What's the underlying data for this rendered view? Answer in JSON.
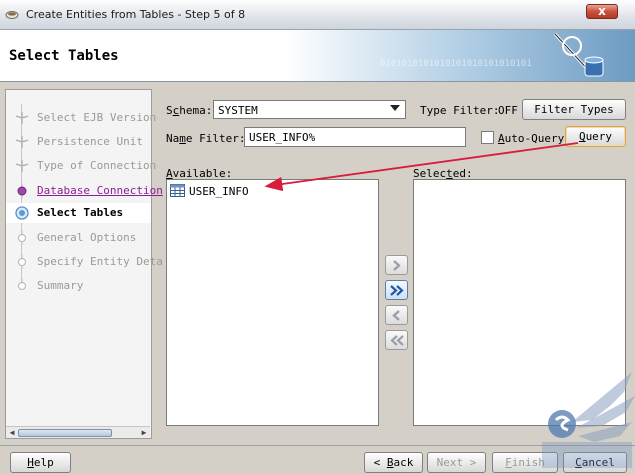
{
  "window": {
    "title": "Create Entities from Tables - Step 5 of 8",
    "close_glyph": "x"
  },
  "header": {
    "title": "Select Tables",
    "banner_binary": "0101010101010101010101010101"
  },
  "nav": {
    "items": [
      {
        "label": "Select EJB Version",
        "state": "done"
      },
      {
        "label": "Persistence Unit",
        "state": "done"
      },
      {
        "label": "Type of Connection",
        "state": "done"
      },
      {
        "label": "Database Connection",
        "state": "visited"
      },
      {
        "label": "Select Tables",
        "state": "active"
      },
      {
        "label": "General Options",
        "state": "pending"
      },
      {
        "label": "Specify Entity Deta",
        "state": "pending"
      },
      {
        "label": "Summary",
        "state": "pending"
      }
    ]
  },
  "form": {
    "schema_label_pre": "S",
    "schema_label_key": "c",
    "schema_label_post": "hema:",
    "schema_value": "SYSTEM",
    "type_filter_label": "Type Filter:",
    "type_filter_value": "OFF",
    "filter_types_button": "Filter Types",
    "name_filter_label_pre": "Na",
    "name_filter_label_key": "m",
    "name_filter_label_post": "e Filter:",
    "name_filter_value": "USER_INFO%",
    "auto_query_key": "A",
    "auto_query_rest": "uto-Query",
    "auto_query_checked": false,
    "query_key": "Q",
    "query_rest": "uery",
    "available_key": "A",
    "available_rest": "vailable:",
    "selected_pre": "Selec",
    "selected_key": "t",
    "selected_post": "ed:",
    "available_items": [
      "USER_INFO"
    ],
    "selected_items": []
  },
  "footer": {
    "help_key": "H",
    "help_rest": "elp",
    "back_key": "B",
    "back_rest": "ack",
    "next_pre": "Next ",
    "next_glyph": ">",
    "finish_key": "F",
    "finish_rest": "inish",
    "cancel_key": "C",
    "cancel_rest": "ancel"
  },
  "colors": {
    "annotation_arrow": "#d81c3c",
    "visited_link": "#8a1f91",
    "focus_border": "#d9a44a"
  }
}
